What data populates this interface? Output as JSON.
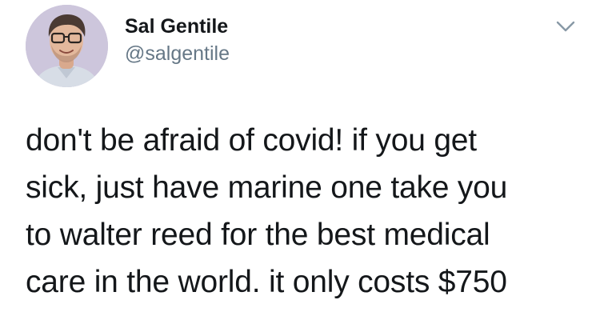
{
  "author": {
    "display_name": "Sal Gentile",
    "handle": "@salgentile"
  },
  "icons": {
    "avatar": "profile-photo",
    "menu": "chevron-down-icon"
  },
  "tweet": {
    "lines": [
      "don't be afraid of covid! if you get",
      "sick, just have marine one take you",
      "to walter reed for the best medical",
      "care in the world. it only costs $750"
    ]
  },
  "colors": {
    "text": "#14171a",
    "secondary": "#657786",
    "background": "#ffffff"
  }
}
